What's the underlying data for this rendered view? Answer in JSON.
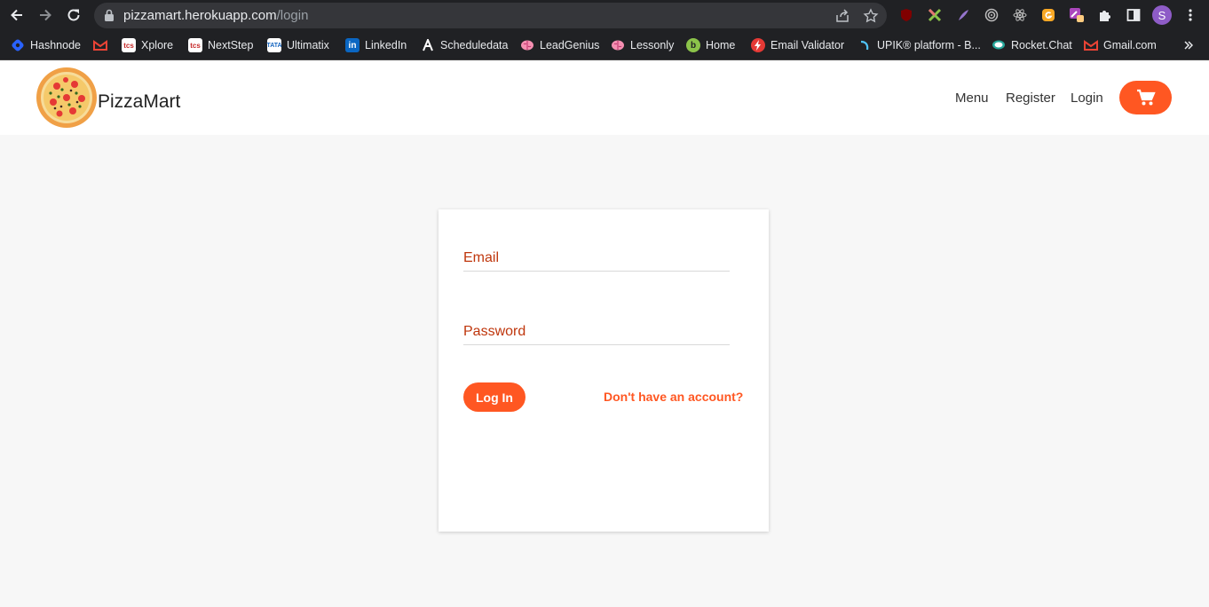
{
  "browser": {
    "url_host": "pizzamart.herokuapp.com",
    "url_path": "/login",
    "avatar_letter": "S"
  },
  "bookmarks": [
    {
      "label": "Hashnode",
      "icon": "hashnode-icon",
      "color": "#2962ff"
    },
    {
      "label": "",
      "icon": "gmail-icon",
      "color": "#ea4335"
    },
    {
      "label": "Xplore",
      "icon": "tcs-icon",
      "color": "#c62828"
    },
    {
      "label": "NextStep",
      "icon": "tcs-icon",
      "color": "#c62828"
    },
    {
      "label": "Ultimatix",
      "icon": "tata-icon",
      "color": "#1565c0"
    },
    {
      "label": "LinkedIn",
      "icon": "linkedin-icon",
      "color": "#0a66c2"
    },
    {
      "label": "Scheduledata",
      "icon": "a-logo-icon",
      "color": "#ffffff"
    },
    {
      "label": "LeadGenius",
      "icon": "brain-icon",
      "color": "#f48fb1"
    },
    {
      "label": "Lessonly",
      "icon": "brain-icon",
      "color": "#f48fb1"
    },
    {
      "label": "Home",
      "icon": "b-circle-icon",
      "color": "#8bc34a"
    },
    {
      "label": "Email Validator",
      "icon": "bolt-circle-icon",
      "color": "#e53935"
    },
    {
      "label": "UPIK® platform - B...",
      "icon": "upik-icon",
      "color": "#4fc3f7"
    },
    {
      "label": "Rocket.Chat",
      "icon": "rocket-chat-icon",
      "color": "#26a69a"
    },
    {
      "label": "Gmail.com",
      "icon": "gmail-icon",
      "color": "#ea4335"
    }
  ],
  "site": {
    "brand": "PizzaMart",
    "nav": [
      "Menu",
      "Register",
      "Login"
    ],
    "accent_color": "#ff5722"
  },
  "login": {
    "email_label": "Email",
    "password_label": "Password",
    "submit_label": "Log In",
    "signup_link": "Don't have an account?"
  }
}
